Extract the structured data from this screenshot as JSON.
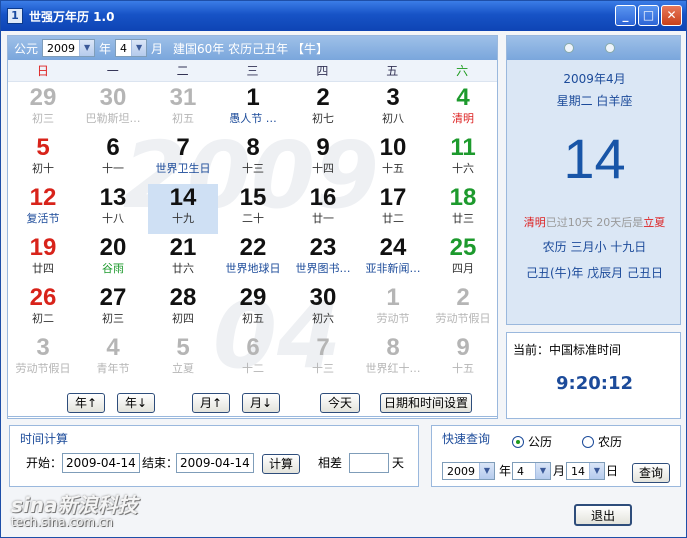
{
  "window": {
    "title": "世强万年历 1.0",
    "icon_label": "1"
  },
  "header": {
    "label_gongyuan": "公元",
    "year": "2009",
    "label_year": "年",
    "month": "4",
    "label_month": "月",
    "info": "建国60年 农历己丑年 【牛】"
  },
  "weekdays": [
    "日",
    "一",
    "二",
    "三",
    "四",
    "五",
    "六"
  ],
  "watermark": {
    "year": "2009",
    "month": "04"
  },
  "days": [
    {
      "d": "29",
      "l": "初三",
      "other": true
    },
    {
      "d": "30",
      "l": "巴勒斯坦…",
      "other": true
    },
    {
      "d": "31",
      "l": "初五",
      "other": true
    },
    {
      "d": "1",
      "l": "愚人节 …",
      "lc": "fest"
    },
    {
      "d": "2",
      "l": "初七"
    },
    {
      "d": "3",
      "l": "初八"
    },
    {
      "d": "4",
      "l": "清明",
      "lc": "red"
    },
    {
      "d": "5",
      "l": "初十"
    },
    {
      "d": "6",
      "l": "十一"
    },
    {
      "d": "7",
      "l": "世界卫生日",
      "lc": "fest"
    },
    {
      "d": "8",
      "l": "十三"
    },
    {
      "d": "9",
      "l": "十四"
    },
    {
      "d": "10",
      "l": "十五"
    },
    {
      "d": "11",
      "l": "十六"
    },
    {
      "d": "12",
      "l": "复活节",
      "lc": "fest"
    },
    {
      "d": "13",
      "l": "十八"
    },
    {
      "d": "14",
      "l": "十九",
      "today": true
    },
    {
      "d": "15",
      "l": "二十"
    },
    {
      "d": "16",
      "l": "廿一"
    },
    {
      "d": "17",
      "l": "廿二"
    },
    {
      "d": "18",
      "l": "廿三"
    },
    {
      "d": "19",
      "l": "廿四"
    },
    {
      "d": "20",
      "l": "谷雨",
      "lc": "green"
    },
    {
      "d": "21",
      "l": "廿六"
    },
    {
      "d": "22",
      "l": "世界地球日",
      "lc": "fest"
    },
    {
      "d": "23",
      "l": "世界图书…",
      "lc": "fest"
    },
    {
      "d": "24",
      "l": "亚非新闻…",
      "lc": "fest"
    },
    {
      "d": "25",
      "l": "四月"
    },
    {
      "d": "26",
      "l": "初二"
    },
    {
      "d": "27",
      "l": "初三"
    },
    {
      "d": "28",
      "l": "初四"
    },
    {
      "d": "29",
      "l": "初五"
    },
    {
      "d": "30",
      "l": "初六"
    },
    {
      "d": "1",
      "l": "劳动节",
      "other": true
    },
    {
      "d": "2",
      "l": "劳动节假日",
      "other": true
    },
    {
      "d": "3",
      "l": "劳动节假日",
      "other": true
    },
    {
      "d": "4",
      "l": "青年节",
      "other": true
    },
    {
      "d": "5",
      "l": "立夏",
      "other": true,
      "lc": "red"
    },
    {
      "d": "6",
      "l": "十二",
      "other": true
    },
    {
      "d": "7",
      "l": "十三",
      "other": true
    },
    {
      "d": "8",
      "l": "世界红十…",
      "other": true
    },
    {
      "d": "9",
      "l": "十五",
      "other": true
    }
  ],
  "nav": {
    "year_up": "年↑",
    "year_down": "年↓",
    "month_up": "月↑",
    "month_down": "月↓",
    "today": "今天",
    "settings": "日期和时间设置"
  },
  "info": {
    "ym": "2009年4月",
    "weekday_star": "星期二  白羊座",
    "big_day": "14",
    "term_a": "清明",
    "term_b": "已过10天  20天后是",
    "term_c": "立夏",
    "lunar1": "农历   三月小  十九日",
    "lunar2": "己丑(牛)年  戊辰月  己丑日"
  },
  "clock": {
    "label": "当前：中国标准时间",
    "time": "9:20:12"
  },
  "calc": {
    "title": "时间计算",
    "start_label": "开始：",
    "start": "2009-04-14",
    "end_label": "结束：",
    "end": "2009-04-14",
    "button": "计算",
    "diff_label": "相差",
    "diff": "",
    "unit": "天"
  },
  "quick": {
    "title": "快速查询",
    "opt_solar": "公历",
    "opt_lunar": "农历",
    "year": "2009",
    "l_year": "年",
    "month": "4",
    "l_month": "月",
    "day": "14",
    "l_day": "日",
    "button": "查询"
  },
  "exit": "退出",
  "brand": {
    "logo": "sina新浪科技",
    "url": "tech.sina.com.cn"
  }
}
